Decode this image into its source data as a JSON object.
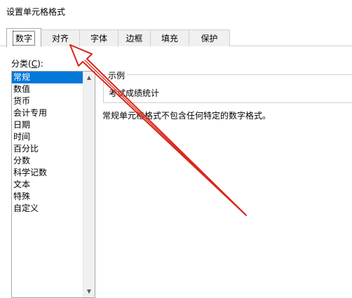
{
  "dialog": {
    "title": "设置单元格格式"
  },
  "tabs": [
    {
      "label": "数字",
      "active": true
    },
    {
      "label": "对齐",
      "active": false
    },
    {
      "label": "字体",
      "active": false
    },
    {
      "label": "边框",
      "active": false
    },
    {
      "label": "填充",
      "active": false
    },
    {
      "label": "保护",
      "active": false
    }
  ],
  "category": {
    "label_prefix": "分类(",
    "label_hotkey": "C",
    "label_suffix": "):",
    "items": [
      "常规",
      "数值",
      "货币",
      "会计专用",
      "日期",
      "时间",
      "百分比",
      "分数",
      "科学记数",
      "文本",
      "特殊",
      "自定义"
    ],
    "selected": "常规"
  },
  "sample": {
    "legend": "示例",
    "value": "考试成绩统计"
  },
  "description": "常规单元格格式不包含任何特定的数字格式。",
  "colors": {
    "selection": "#0078d7",
    "annotation_arrow": "#d9261c"
  },
  "icons": {
    "scroll_up": "▲",
    "scroll_down": "▼"
  }
}
